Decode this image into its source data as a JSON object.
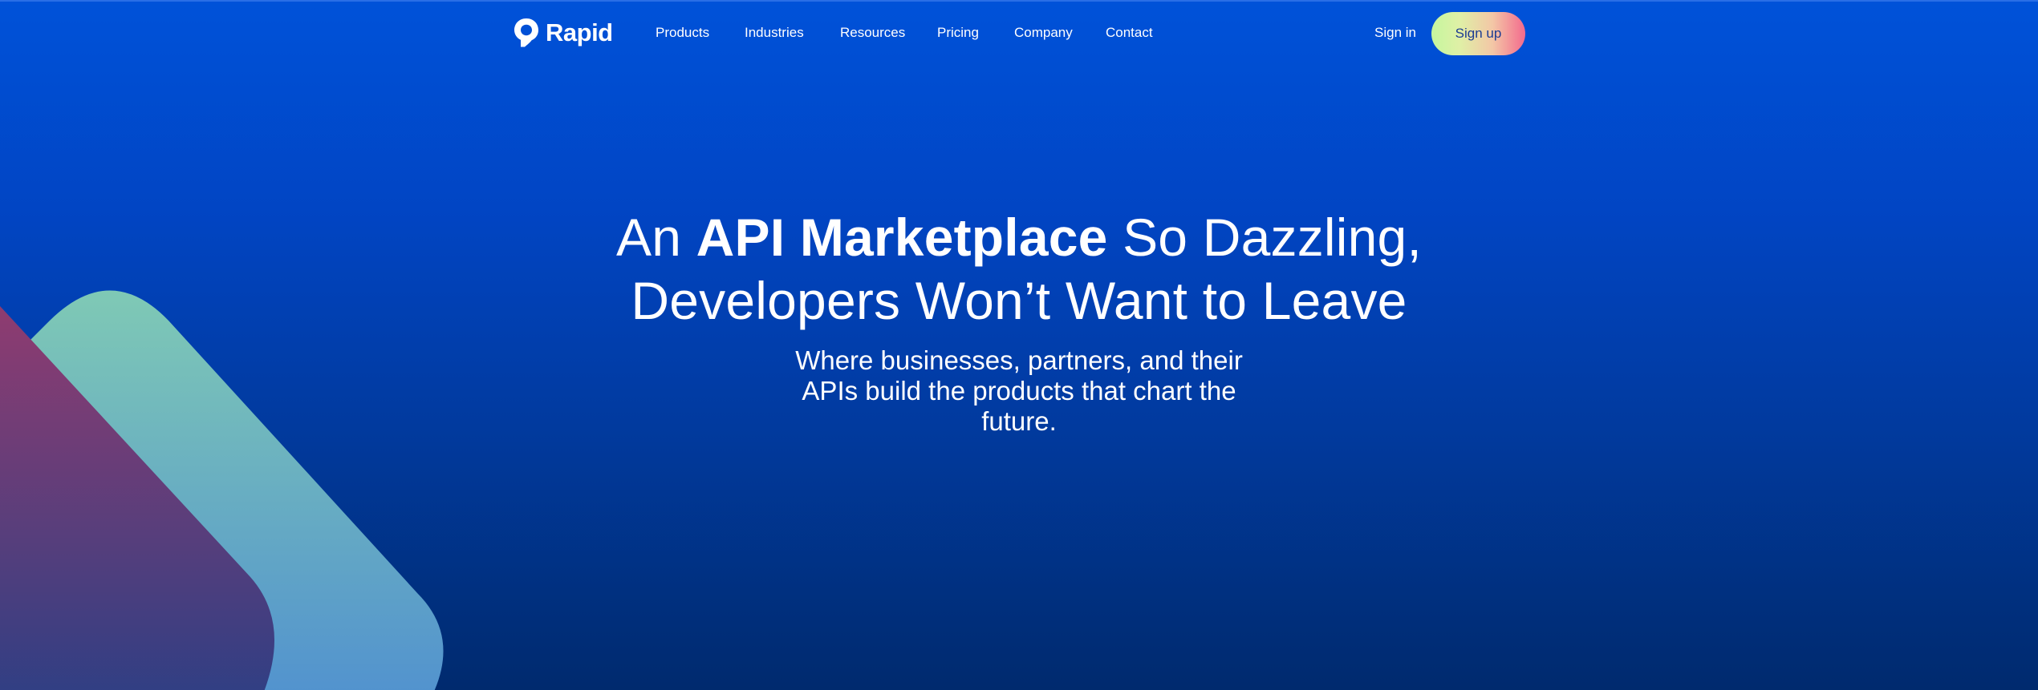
{
  "brand": {
    "name": "Rapid"
  },
  "nav": {
    "links": [
      {
        "label": "Products"
      },
      {
        "label": "Industries"
      },
      {
        "label": "Resources"
      },
      {
        "label": "Pricing"
      },
      {
        "label": "Company"
      },
      {
        "label": "Contact"
      }
    ],
    "sign_in": "Sign in",
    "sign_up": "Sign up"
  },
  "hero": {
    "title_prefix": "An ",
    "title_bold": "API Marketplace",
    "title_suffix": " So Dazzling,",
    "title_line2": "Developers Won’t Want to Leave",
    "subtitle": "Where businesses, partners, and their APIs build the products that chart the future."
  },
  "colors": {
    "background_top": "#0052d9",
    "background_bottom": "#002a6e",
    "signup_gradient_start": "#c5f79e",
    "signup_gradient_end": "#f36a8d",
    "signup_text": "#1c3c92",
    "decor_teal": "#7cc4b8",
    "decor_magenta": "#8b3a6e"
  },
  "icons": {
    "logo": "rapid-logo-icon"
  }
}
